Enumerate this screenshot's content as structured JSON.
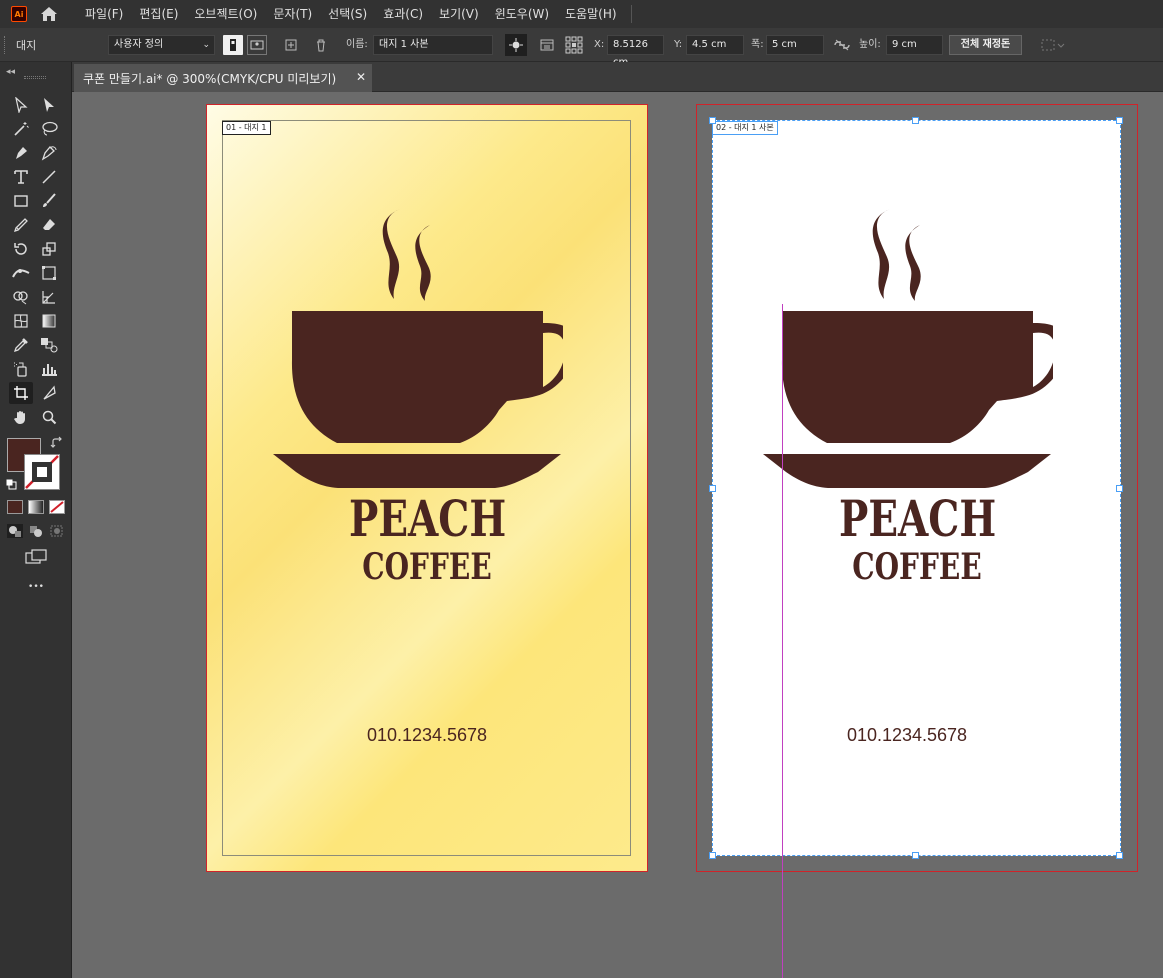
{
  "app": {
    "logo_text": "Ai"
  },
  "menu": {
    "items": [
      "파일(F)",
      "편집(E)",
      "오브젝트(O)",
      "문자(T)",
      "선택(S)",
      "효과(C)",
      "보기(V)",
      "윈도우(W)",
      "도움말(H)"
    ]
  },
  "control_bar": {
    "title": "대지",
    "preset": "사용자 정의",
    "name_label": "이름:",
    "name_value": "대지 1 사본",
    "x_label": "X:",
    "x_value": "8.5126 cm",
    "y_label": "Y:",
    "y_value": "4.5 cm",
    "width_label": "폭:",
    "width_value": "5 cm",
    "height_label": "높이:",
    "height_value": "9 cm",
    "reset_button": "전체 재정돈"
  },
  "toolbar": {
    "collapse_glyph": "◂◂",
    "more_glyph": "•••",
    "fill_color": "#4a2520"
  },
  "document": {
    "tab_title": "쿠폰 만들기.ai* @ 300%(CMYK/CPU 미리보기)",
    "close_glyph": "✕"
  },
  "artboards": [
    {
      "label": "01 - 대지 1",
      "brand": "PEACH",
      "subtitle": "COFFEE",
      "phone": "010.1234.5678",
      "background": "yellow-gradient"
    },
    {
      "label": "02 - 대지 1 사본",
      "brand": "PEACH",
      "subtitle": "COFFEE",
      "phone": "010.1234.5678",
      "background": "#ffffff"
    }
  ],
  "colors": {
    "coffee_brown": "#4a2520",
    "artboard_border": "#d0232a",
    "selection": "#4a9ff5",
    "guide": "#c040c0"
  }
}
